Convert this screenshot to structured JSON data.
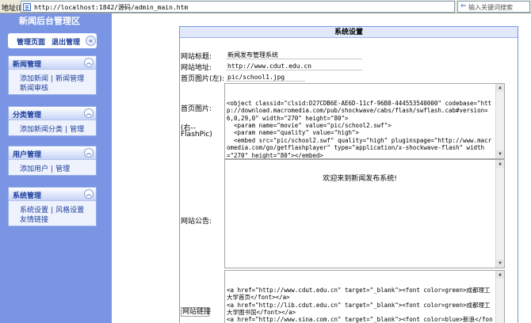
{
  "address_bar": {
    "label": "地址(D)",
    "url": "http://localhost:1842/源码/admin_main.htm",
    "search_placeholder": "输入关键词搜索"
  },
  "sidebar": {
    "site_title": "新闻后台管理区",
    "top_tabs": {
      "home": "管理页面",
      "logout": "退出管理"
    },
    "sections": [
      {
        "title": "新闻管理",
        "rows": [
          [
            "添加新闻",
            "新闻管理"
          ],
          [
            "新闻审核"
          ]
        ]
      },
      {
        "title": "分类管理",
        "rows": [
          [
            "添加新闻分类",
            "管理"
          ]
        ]
      },
      {
        "title": "用户管理",
        "rows": [
          [
            "添加用户",
            "管理"
          ]
        ]
      },
      {
        "title": "系统管理",
        "rows": [
          [
            "系统设置",
            "风格设置"
          ],
          [
            "友情链接"
          ]
        ]
      }
    ]
  },
  "main": {
    "header": "系统设置",
    "site_title_label": "网站标题:",
    "site_title_value": "新闻发布管理系统",
    "site_url_label": "网站地址:",
    "site_url_value": "http://www.cdut.edu.cn",
    "home_pic_label": "首页图片(左):",
    "home_pic_value": "pic/school1.jpg",
    "flash_label_1": "首页图片:",
    "flash_label_2": "(右--",
    "flash_label_3": "FlashPic)",
    "flash_code": "<object classid=\"clsid:D27CDB6E-AE6D-11cf-96B8-444553540000\" codebase=\"http://download.macromedia.com/pub/shockwave/cabs/flash/swflash.cab#version=6,0,29,0\" width=\"270\" height=\"80\">\n  <param name=\"movie\" value=\"pic/school2.swf\">\n  <param name=\"quality\" value=\"high\">\n  <embed src=\"pic/school2.swf\" quality=\"high\" pluginspage=\"http://www.macromedia.com/go/getflashplayer\" type=\"application/x-shockwave-flash\" width=\"270\" height=\"80\"></embed>\n</object>",
    "notice_label": "网站公告:",
    "notice_text": "欢迎来到新闻发布系统!",
    "links_label": "网站链接",
    "links_code": "<a href=\"http://www.cdut.edu.cn\" target=\"_blank\"><font color=green>成都理工大学首页</font></a>\n<a href=\"http://lib.cdut.edu.cn\" target=\"_blank\"><font color=green>成都理工大学图书馆</font></a>\n<a href=\"http://www.sina.com.cn\" target=\"_blank\"><font color=blue>新浪</font></a>\n<a href=\"http://www.sohu.com\" target=\"_blank\"><font color=blue>搜狐"
  },
  "colors": {
    "sidebar_bg": "#7a95e4",
    "link": "#1c3e9c",
    "header_bg": "#e0e8fa"
  }
}
